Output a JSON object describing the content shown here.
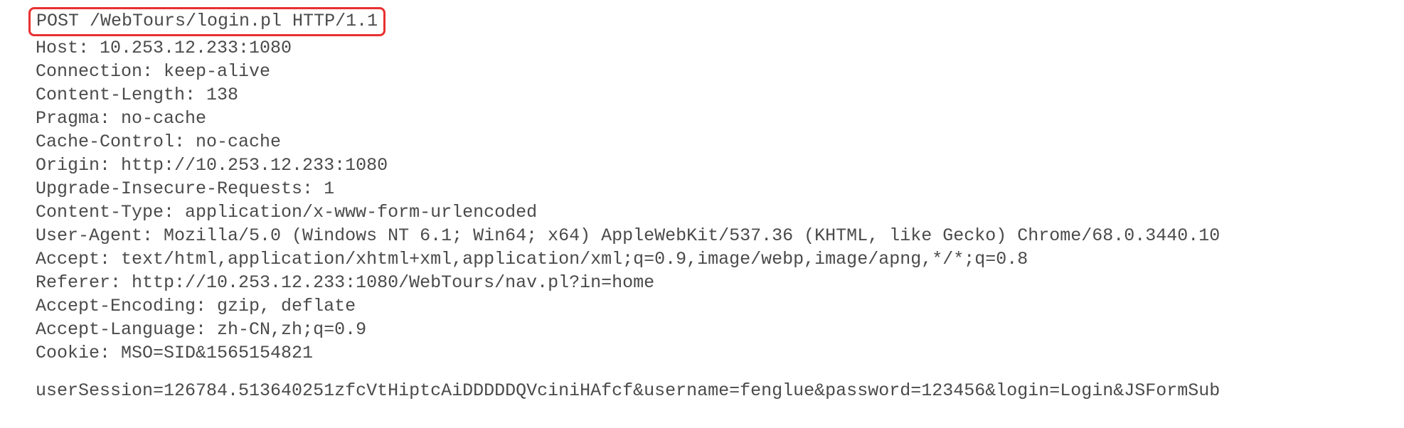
{
  "request_line": "POST /WebTours/login.pl HTTP/1.1",
  "headers": [
    "Host: 10.253.12.233:1080",
    "Connection: keep-alive",
    "Content-Length: 138",
    "Pragma: no-cache",
    "Cache-Control: no-cache",
    "Origin: http://10.253.12.233:1080",
    "Upgrade-Insecure-Requests: 1",
    "Content-Type: application/x-www-form-urlencoded",
    "User-Agent: Mozilla/5.0 (Windows NT 6.1; Win64; x64) AppleWebKit/537.36 (KHTML, like Gecko) Chrome/68.0.3440.10",
    "Accept: text/html,application/xhtml+xml,application/xml;q=0.9,image/webp,image/apng,*/*;q=0.8",
    "Referer: http://10.253.12.233:1080/WebTours/nav.pl?in=home",
    "Accept-Encoding: gzip, deflate",
    "Accept-Language: zh-CN,zh;q=0.9",
    "Cookie: MSO=SID&1565154821"
  ],
  "body": "userSession=126784.513640251zfcVtHiptcAiDDDDDQVciniHAfcf&username=fenglue&password=123456&login=Login&JSFormSub"
}
